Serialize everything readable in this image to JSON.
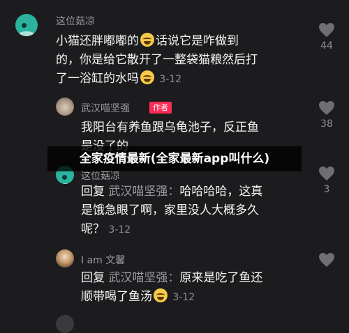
{
  "comments": [
    {
      "username": "这位菇凉",
      "lines": [
        "小猫还胖嘟嘟的",
        "话说它是咋做到",
        "的，你是给它散开了一整袋猫粮然后打",
        "了一浴缸的水吗"
      ],
      "date": "3-12",
      "likes": "44"
    },
    {
      "username": "武汉喵坚强",
      "badge": "作者",
      "lines": [
        "我阳台有养鱼跟乌龟池子，反正鱼",
        "是没了的"
      ],
      "likes": "38"
    },
    {
      "username": "这位菇凉",
      "reply_prefix": "回复",
      "reply_to": "武汉喵坚强：",
      "lines": [
        "哈哈哈哈，这真",
        "是饿急眼了啊，家里没人大概多久",
        "呢？"
      ],
      "date": "3-12",
      "likes": "3"
    },
    {
      "username": "I am  文馨",
      "reply_prefix": "回复",
      "reply_to": "武汉喵坚强：",
      "lines": [
        "原来是吃了鱼还",
        "顺带喝了鱼汤"
      ],
      "date": "3-12"
    }
  ],
  "banner": "全家疫情最新(全家最新app叫什么)",
  "icons": {
    "like": "heart-outline-icon",
    "emoji": "laughing-tears-emoji-icon"
  },
  "colors": {
    "background": "#1c1c1e",
    "badge": "#fe2c55",
    "secondary_text": "#9a9a9e"
  }
}
